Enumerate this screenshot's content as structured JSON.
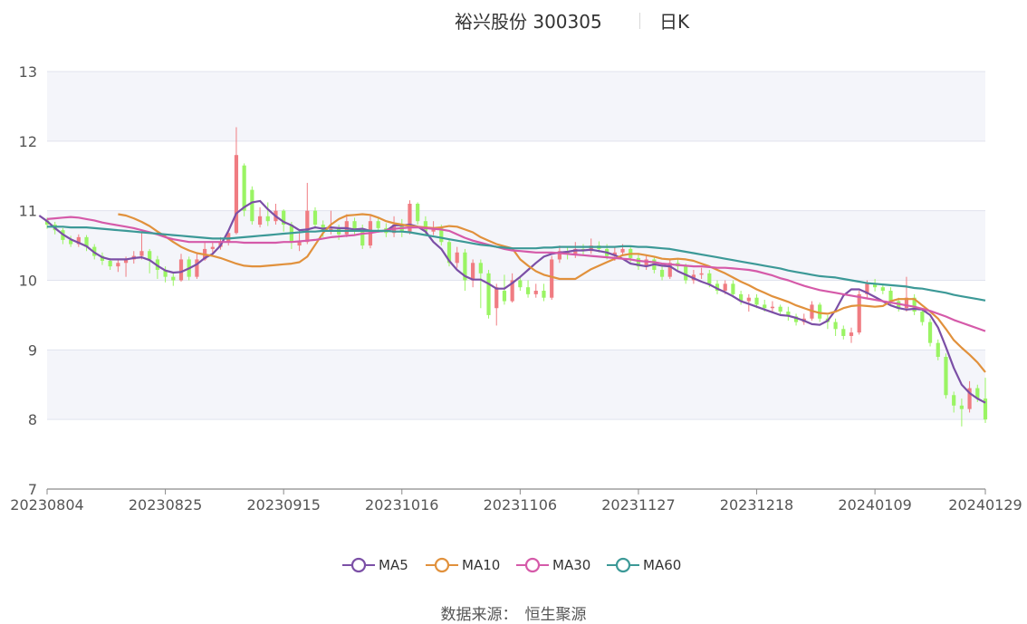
{
  "header": {
    "title": "裕兴股份 300305",
    "period": "日K"
  },
  "source": {
    "label": "数据来源：",
    "name": "恒生聚源"
  },
  "colors": {
    "up": "#f07c82",
    "down": "#9af464",
    "ma5": "#7b4fa6",
    "ma10": "#e1913c",
    "ma30": "#d55aa9",
    "ma60": "#3c9997",
    "band": "#f4f5fa",
    "grid": "#e0e3ee",
    "axis": "#8a8a8a"
  },
  "chart_data": {
    "type": "candlestick",
    "title": "裕兴股份 300305",
    "y_ticks": [
      7,
      8,
      9,
      10,
      11,
      12,
      13
    ],
    "ylim": [
      7,
      13
    ],
    "x_tick_labels": [
      "20230804",
      "20230825",
      "20230915",
      "20231016",
      "20231106",
      "20231127",
      "20231218",
      "20240109",
      "20240129"
    ],
    "x_tick_index": [
      0,
      15,
      30,
      45,
      60,
      75,
      90,
      105,
      119
    ],
    "legend": [
      "MA5",
      "MA10",
      "MA30",
      "MA60"
    ],
    "candles": [
      [
        10.86,
        10.8,
        10.9,
        10.74
      ],
      [
        10.8,
        10.72,
        10.84,
        10.66
      ],
      [
        10.72,
        10.58,
        10.75,
        10.52
      ],
      [
        10.58,
        10.52,
        10.64,
        10.48
      ],
      [
        10.52,
        10.62,
        10.66,
        10.48
      ],
      [
        10.62,
        10.48,
        10.65,
        10.42
      ],
      [
        10.48,
        10.35,
        10.52,
        10.3
      ],
      [
        10.35,
        10.28,
        10.4,
        10.22
      ],
      [
        10.28,
        10.2,
        10.32,
        10.15
      ],
      [
        10.2,
        10.25,
        10.3,
        10.12
      ],
      [
        10.25,
        10.3,
        10.34,
        10.05
      ],
      [
        10.3,
        10.35,
        10.42,
        10.24
      ],
      [
        10.35,
        10.42,
        10.7,
        10.3
      ],
      [
        10.42,
        10.3,
        10.45,
        10.1
      ],
      [
        10.3,
        10.15,
        10.35,
        10.02
      ],
      [
        10.15,
        10.05,
        10.2,
        9.97
      ],
      [
        10.05,
        10.0,
        10.12,
        9.92
      ],
      [
        10.0,
        10.3,
        10.38,
        9.98
      ],
      [
        10.3,
        10.05,
        10.34,
        10.0
      ],
      [
        10.05,
        10.3,
        10.4,
        10.02
      ],
      [
        10.3,
        10.45,
        10.55,
        10.28
      ],
      [
        10.45,
        10.48,
        10.55,
        10.38
      ],
      [
        10.48,
        10.55,
        10.62,
        10.44
      ],
      [
        10.55,
        10.68,
        10.72,
        10.5
      ],
      [
        10.68,
        11.8,
        12.2,
        10.66
      ],
      [
        11.65,
        11.0,
        11.68,
        10.92
      ],
      [
        11.3,
        10.85,
        11.35,
        10.8
      ],
      [
        10.8,
        10.92,
        11.05,
        10.76
      ],
      [
        10.92,
        10.85,
        11.12,
        10.78
      ],
      [
        10.85,
        11.0,
        11.1,
        10.8
      ],
      [
        11.0,
        10.8,
        11.02,
        10.7
      ],
      [
        10.8,
        10.55,
        10.84,
        10.45
      ],
      [
        10.5,
        10.55,
        10.72,
        10.42
      ],
      [
        10.55,
        11.0,
        11.4,
        10.52
      ],
      [
        11.0,
        10.8,
        11.05,
        10.74
      ],
      [
        10.8,
        10.7,
        10.86,
        10.62
      ],
      [
        10.7,
        10.74,
        11.0,
        10.66
      ],
      [
        10.74,
        10.66,
        10.8,
        10.58
      ],
      [
        10.66,
        10.85,
        10.95,
        10.62
      ],
      [
        10.85,
        10.72,
        10.9,
        10.66
      ],
      [
        10.72,
        10.5,
        10.8,
        10.45
      ],
      [
        10.5,
        10.85,
        10.95,
        10.46
      ],
      [
        10.85,
        10.75,
        10.9,
        10.7
      ],
      [
        10.75,
        10.68,
        10.82,
        10.62
      ],
      [
        10.68,
        10.8,
        10.92,
        10.62
      ],
      [
        10.8,
        10.7,
        10.88,
        10.62
      ],
      [
        10.7,
        11.1,
        11.15,
        10.66
      ],
      [
        11.1,
        10.85,
        11.12,
        10.8
      ],
      [
        10.85,
        10.7,
        10.92,
        10.64
      ],
      [
        10.7,
        10.75,
        10.85,
        10.65
      ],
      [
        10.75,
        10.55,
        10.8,
        10.5
      ],
      [
        10.55,
        10.25,
        10.6,
        10.2
      ],
      [
        10.25,
        10.4,
        10.48,
        10.18
      ],
      [
        10.4,
        10.0,
        10.45,
        9.85
      ],
      [
        10.0,
        10.25,
        10.3,
        9.9
      ],
      [
        10.25,
        10.1,
        10.3,
        9.6
      ],
      [
        10.1,
        9.5,
        10.15,
        9.45
      ],
      [
        9.6,
        9.9,
        9.95,
        9.35
      ],
      [
        9.85,
        9.7,
        10.08,
        9.65
      ],
      [
        9.7,
        10.0,
        10.1,
        9.68
      ],
      [
        10.0,
        9.9,
        10.05,
        9.85
      ],
      [
        9.9,
        9.8,
        10.0,
        9.75
      ],
      [
        9.8,
        9.85,
        9.95,
        9.75
      ],
      [
        9.85,
        9.75,
        9.95,
        9.7
      ],
      [
        9.75,
        10.3,
        10.35,
        9.72
      ],
      [
        10.3,
        10.42,
        10.5,
        10.25
      ],
      [
        10.42,
        10.38,
        10.48,
        10.3
      ],
      [
        10.38,
        10.45,
        10.55,
        10.32
      ],
      [
        10.45,
        10.42,
        10.52,
        10.36
      ],
      [
        10.42,
        10.5,
        10.6,
        10.38
      ],
      [
        10.5,
        10.45,
        10.56,
        10.4
      ],
      [
        10.45,
        10.35,
        10.52,
        10.3
      ],
      [
        10.35,
        10.4,
        10.48,
        10.28
      ],
      [
        10.4,
        10.45,
        10.52,
        10.35
      ],
      [
        10.45,
        10.32,
        10.48,
        10.26
      ],
      [
        10.32,
        10.2,
        10.38,
        10.15
      ],
      [
        10.2,
        10.3,
        10.36,
        10.15
      ],
      [
        10.3,
        10.15,
        10.35,
        10.1
      ],
      [
        10.15,
        10.05,
        10.25,
        10.0
      ],
      [
        10.05,
        10.25,
        10.3,
        10.02
      ],
      [
        10.25,
        10.2,
        10.32,
        10.15
      ],
      [
        10.2,
        10.0,
        10.24,
        9.95
      ],
      [
        10.0,
        10.08,
        10.15,
        9.95
      ],
      [
        10.08,
        10.1,
        10.18,
        10.02
      ],
      [
        10.1,
        9.95,
        10.15,
        9.9
      ],
      [
        9.95,
        9.85,
        10.0,
        9.8
      ],
      [
        9.85,
        9.95,
        10.0,
        9.8
      ],
      [
        9.95,
        9.8,
        10.0,
        9.75
      ],
      [
        9.8,
        9.7,
        9.85,
        9.65
      ],
      [
        9.7,
        9.75,
        9.8,
        9.55
      ],
      [
        9.75,
        9.65,
        9.8,
        9.6
      ],
      [
        9.65,
        9.6,
        9.72,
        9.55
      ],
      [
        9.6,
        9.62,
        9.7,
        9.55
      ],
      [
        9.62,
        9.55,
        9.65,
        9.5
      ],
      [
        9.55,
        9.48,
        9.62,
        9.42
      ],
      [
        9.48,
        9.4,
        9.52,
        9.35
      ],
      [
        9.4,
        9.45,
        9.52,
        9.36
      ],
      [
        9.45,
        9.65,
        9.7,
        9.42
      ],
      [
        9.65,
        9.45,
        9.68,
        9.4
      ],
      [
        9.45,
        9.4,
        9.5,
        9.3
      ],
      [
        9.4,
        9.3,
        9.45,
        9.2
      ],
      [
        9.3,
        9.2,
        9.35,
        9.15
      ],
      [
        9.2,
        9.25,
        9.32,
        9.1
      ],
      [
        9.25,
        9.8,
        9.85,
        9.22
      ],
      [
        9.8,
        9.95,
        10.0,
        9.75
      ],
      [
        9.95,
        9.9,
        10.02,
        9.84
      ],
      [
        9.9,
        9.85,
        9.95,
        9.8
      ],
      [
        9.85,
        9.7,
        9.9,
        9.65
      ],
      [
        9.7,
        9.6,
        9.75,
        9.55
      ],
      [
        9.6,
        9.75,
        10.05,
        9.55
      ],
      [
        9.75,
        9.55,
        9.8,
        9.5
      ],
      [
        9.55,
        9.4,
        9.6,
        9.35
      ],
      [
        9.4,
        9.1,
        9.45,
        9.05
      ],
      [
        9.1,
        8.9,
        9.15,
        8.85
      ],
      [
        8.9,
        8.35,
        8.95,
        8.3
      ],
      [
        8.35,
        8.2,
        8.4,
        8.1
      ],
      [
        8.2,
        8.15,
        8.3,
        7.9
      ],
      [
        8.15,
        8.45,
        8.55,
        8.1
      ],
      [
        8.45,
        8.3,
        8.5,
        8.25
      ],
      [
        8.3,
        8.0,
        8.6,
        7.95
      ]
    ],
    "series": [
      {
        "name": "MA5",
        "values": [
          10.93,
          10.85,
          10.75,
          10.66,
          10.59,
          10.54,
          10.49,
          10.4,
          10.33,
          10.3,
          10.3,
          10.3,
          10.32,
          10.33,
          10.29,
          10.21,
          10.14,
          10.11,
          10.12,
          10.17,
          10.23,
          10.32,
          10.38,
          10.5,
          10.71,
          10.96,
          11.05,
          11.12,
          11.14,
          11.02,
          10.92,
          10.84,
          10.79,
          10.72,
          10.73,
          10.76,
          10.74,
          10.76,
          10.75,
          10.75,
          10.73,
          10.74,
          10.71,
          10.7,
          10.71,
          10.79,
          10.79,
          10.8,
          10.77,
          10.7,
          10.55,
          10.45,
          10.28,
          10.15,
          10.06,
          10.01,
          10.01,
          9.95,
          9.88,
          9.88,
          9.96,
          10.05,
          10.15,
          10.25,
          10.34,
          10.38,
          10.4,
          10.41,
          10.43,
          10.43,
          10.44,
          10.42,
          10.4,
          10.36,
          10.31,
          10.24,
          10.22,
          10.2,
          10.23,
          10.21,
          10.2,
          10.13,
          10.08,
          10.03,
          9.98,
          9.94,
          9.88,
          9.83,
          9.77,
          9.7,
          9.66,
          9.62,
          9.58,
          9.54,
          9.5,
          9.49,
          9.46,
          9.42,
          9.37,
          9.36,
          9.42,
          9.57,
          9.78,
          9.87,
          9.87,
          9.82,
          9.76,
          9.7,
          9.64,
          9.6,
          9.58,
          9.59,
          9.58,
          9.5,
          9.32,
          9.04,
          8.74,
          8.5,
          8.38,
          8.3,
          8.24
        ]
      },
      {
        "name": "MA10",
        "values": [
          10.95,
          10.93,
          10.89,
          10.84,
          10.78,
          10.7,
          10.63,
          10.55,
          10.48,
          10.43,
          10.39,
          10.37,
          10.35,
          10.32,
          10.28,
          10.24,
          10.21,
          10.2,
          10.2,
          10.21,
          10.22,
          10.23,
          10.24,
          10.26,
          10.34,
          10.51,
          10.68,
          10.8,
          10.88,
          10.93,
          10.94,
          10.95,
          10.94,
          10.9,
          10.85,
          10.82,
          10.8,
          10.78,
          10.77,
          10.76,
          10.75,
          10.76,
          10.78,
          10.77,
          10.73,
          10.69,
          10.62,
          10.57,
          10.52,
          10.49,
          10.46,
          10.3,
          10.21,
          10.13,
          10.08,
          10.05,
          10.02,
          10.02,
          10.02,
          10.09,
          10.16,
          10.21,
          10.26,
          10.31,
          10.36,
          10.38,
          10.38,
          10.36,
          10.34,
          10.31,
          10.3,
          10.31,
          10.3,
          10.28,
          10.24,
          10.2,
          10.15,
          10.1,
          10.04,
          9.98,
          9.93,
          9.87,
          9.82,
          9.77,
          9.73,
          9.69,
          9.64,
          9.6,
          9.56,
          9.53,
          9.52,
          9.55,
          9.6,
          9.63,
          9.64,
          9.63,
          9.62,
          9.63,
          9.7,
          9.73,
          9.73,
          9.73,
          9.64,
          9.55,
          9.45,
          9.3,
          9.14,
          9.03,
          8.93,
          8.82,
          8.68
        ]
      },
      {
        "name": "MA30",
        "values": [
          10.88,
          10.89,
          10.9,
          10.91,
          10.9,
          10.88,
          10.86,
          10.83,
          10.81,
          10.79,
          10.77,
          10.75,
          10.72,
          10.69,
          10.66,
          10.62,
          10.59,
          10.57,
          10.55,
          10.55,
          10.55,
          10.55,
          10.55,
          10.55,
          10.55,
          10.54,
          10.54,
          10.54,
          10.54,
          10.54,
          10.55,
          10.55,
          10.56,
          10.57,
          10.58,
          10.6,
          10.62,
          10.63,
          10.64,
          10.65,
          10.67,
          10.68,
          10.7,
          10.72,
          10.74,
          10.75,
          10.76,
          10.76,
          10.75,
          10.74,
          10.73,
          10.71,
          10.66,
          10.61,
          10.57,
          10.54,
          10.51,
          10.48,
          10.45,
          10.43,
          10.42,
          10.41,
          10.4,
          10.4,
          10.4,
          10.39,
          10.38,
          10.37,
          10.36,
          10.35,
          10.34,
          10.33,
          10.32,
          10.31,
          10.3,
          10.28,
          10.27,
          10.26,
          10.24,
          10.23,
          10.22,
          10.21,
          10.2,
          10.2,
          10.19,
          10.18,
          10.18,
          10.17,
          10.16,
          10.15,
          10.13,
          10.1,
          10.07,
          10.03,
          10.0,
          9.96,
          9.92,
          9.89,
          9.86,
          9.84,
          9.82,
          9.8,
          9.78,
          9.76,
          9.74,
          9.72,
          9.7,
          9.68,
          9.66,
          9.64,
          9.62,
          9.59,
          9.56,
          9.52,
          9.48,
          9.43,
          9.39,
          9.35,
          9.31,
          9.27
        ]
      },
      {
        "name": "MA60",
        "values": [
          10.77,
          10.77,
          10.77,
          10.76,
          10.76,
          10.76,
          10.75,
          10.74,
          10.73,
          10.72,
          10.71,
          10.7,
          10.69,
          10.68,
          10.67,
          10.66,
          10.65,
          10.64,
          10.63,
          10.62,
          10.61,
          10.6,
          10.6,
          10.6,
          10.61,
          10.62,
          10.63,
          10.64,
          10.65,
          10.66,
          10.67,
          10.68,
          10.69,
          10.7,
          10.7,
          10.71,
          10.71,
          10.71,
          10.71,
          10.71,
          10.71,
          10.71,
          10.71,
          10.71,
          10.7,
          10.7,
          10.69,
          10.67,
          10.65,
          10.63,
          10.61,
          10.59,
          10.57,
          10.55,
          10.53,
          10.51,
          10.5,
          10.48,
          10.47,
          10.46,
          10.46,
          10.46,
          10.46,
          10.47,
          10.47,
          10.48,
          10.48,
          10.48,
          10.48,
          10.48,
          10.48,
          10.48,
          10.48,
          10.49,
          10.49,
          10.48,
          10.48,
          10.47,
          10.46,
          10.45,
          10.43,
          10.41,
          10.39,
          10.37,
          10.35,
          10.33,
          10.31,
          10.29,
          10.27,
          10.25,
          10.23,
          10.21,
          10.19,
          10.17,
          10.14,
          10.12,
          10.1,
          10.08,
          10.06,
          10.05,
          10.04,
          10.02,
          10.0,
          9.98,
          9.96,
          9.95,
          9.94,
          9.93,
          9.92,
          9.91,
          9.89,
          9.88,
          9.86,
          9.84,
          9.82,
          9.79,
          9.77,
          9.75,
          9.73,
          9.71
        ]
      }
    ]
  }
}
